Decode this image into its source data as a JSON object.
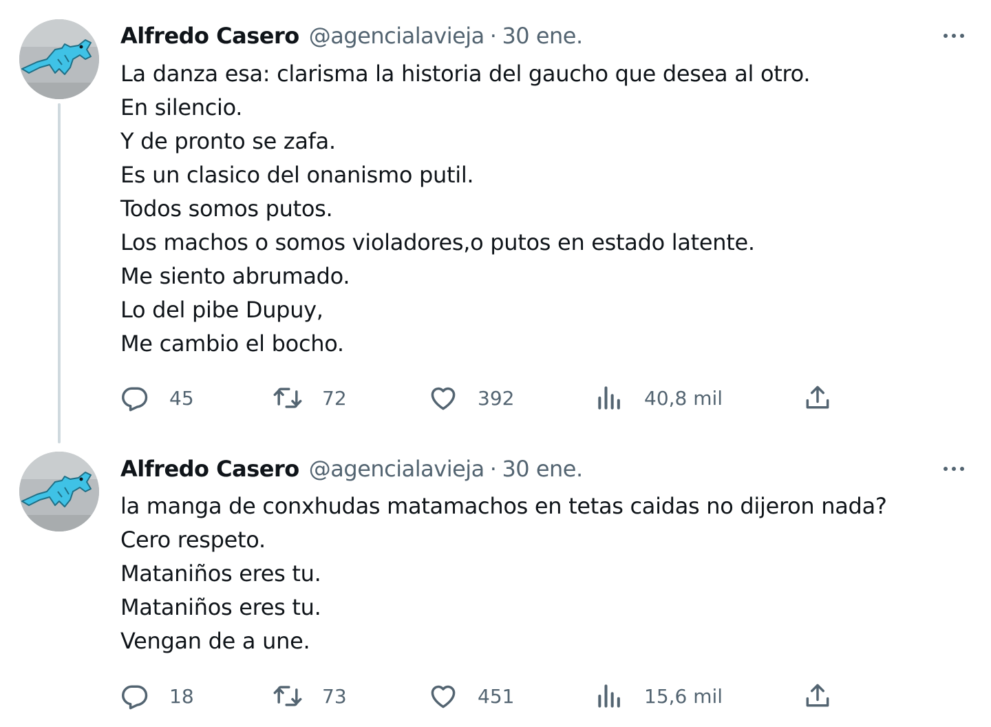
{
  "tweets": [
    {
      "author_name": "Alfredo Casero",
      "handle": "@agencialavieja",
      "separator": "·",
      "time": "30 ene.",
      "lines": [
        "La danza esa: clarisma la historia del gaucho que desea al otro.",
        "En silencio.",
        "Y de pronto se zafa.",
        "Es un clasico del onanismo putil.",
        "Todos somos putos.",
        "Los machos o somos violadores,o putos en estado latente.",
        "Me siento abrumado.",
        "Lo del pibe Dupuy,",
        "Me cambio el bocho."
      ],
      "stats": {
        "replies": "45",
        "retweets": "72",
        "likes": "392",
        "views": "40,8 mil"
      }
    },
    {
      "author_name": "Alfredo Casero",
      "handle": "@agencialavieja",
      "separator": "·",
      "time": "30 ene.",
      "lines": [
        "la manga de conxhudas matamachos en tetas caidas no dijeron nada?",
        "Cero respeto.",
        "Mataniños eres tu.",
        "Mataniños eres tu.",
        "Vengan de a une."
      ],
      "stats": {
        "replies": "18",
        "retweets": "73",
        "likes": "451",
        "views": "15,6 mil"
      }
    }
  ],
  "icons": {
    "avatar": "blue-fish-drawing-avatar",
    "more": "more-dots-icon",
    "reply": "reply-icon",
    "retweet": "retweet-icon",
    "like": "heart-icon",
    "views": "views-chart-icon",
    "share": "share-icon"
  },
  "colors": {
    "text": "#0f1419",
    "secondary": "#536471",
    "thread_line": "#cfd9de",
    "avatar_fish": "#3fc2e6"
  }
}
